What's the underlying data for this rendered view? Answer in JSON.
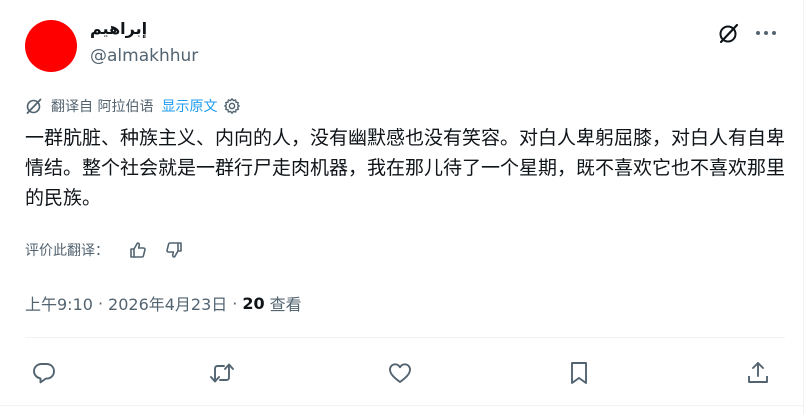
{
  "author": {
    "display_name": "إبراهيم",
    "handle": "@almakhhur",
    "avatar_color": "#ff0000"
  },
  "header_icons": {
    "grok": "grok-icon",
    "more": "more-icon"
  },
  "translation": {
    "label": "翻译自 阿拉伯语",
    "show_original": "显示原文"
  },
  "tweet": {
    "text": "一群肮脏、种族主义、内向的人，没有幽默感也没有笑容。对白人卑躬屈膝，对白人有自卑情结。整个社会就是一群行尸走肉机器，我在那儿待了一个星期，既不喜欢它也不喜欢那里的民族。"
  },
  "rate_translation": {
    "label": "评价此翻译："
  },
  "meta": {
    "time": "上午9:10",
    "separator": "·",
    "date": "2026年4月23日",
    "views_count": "20",
    "views_label": "查看"
  },
  "actions": {
    "reply": "reply-icon",
    "retweet": "retweet-icon",
    "like": "like-icon",
    "bookmark": "bookmark-icon",
    "share": "share-icon"
  },
  "colors": {
    "accent": "#1d9bf0",
    "secondary_text": "#536471",
    "primary_text": "#0f1419"
  }
}
